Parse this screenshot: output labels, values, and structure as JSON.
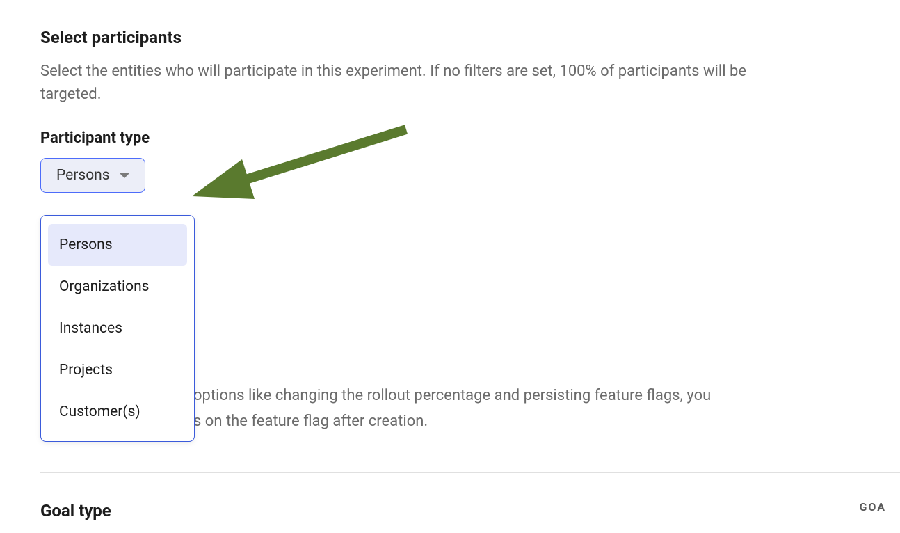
{
  "section": {
    "title": "Select participants",
    "description": "Select the entities who will participate in this experiment. If no filters are set, 100% of participants will be targeted."
  },
  "participant_type": {
    "label": "Participant type",
    "selected": "Persons",
    "options": [
      "Persons",
      "Organizations",
      "Instances",
      "Projects",
      "Customer(s)"
    ]
  },
  "hint": {
    "line1_fragment": " options like changing the rollout percentage and persisting feature flags, you",
    "line2_fragment": "s on the feature flag after creation."
  },
  "goal": {
    "title": "Goal type"
  },
  "badge": {
    "text": "GOA"
  },
  "colors": {
    "arrow": "#5a7a2e"
  }
}
